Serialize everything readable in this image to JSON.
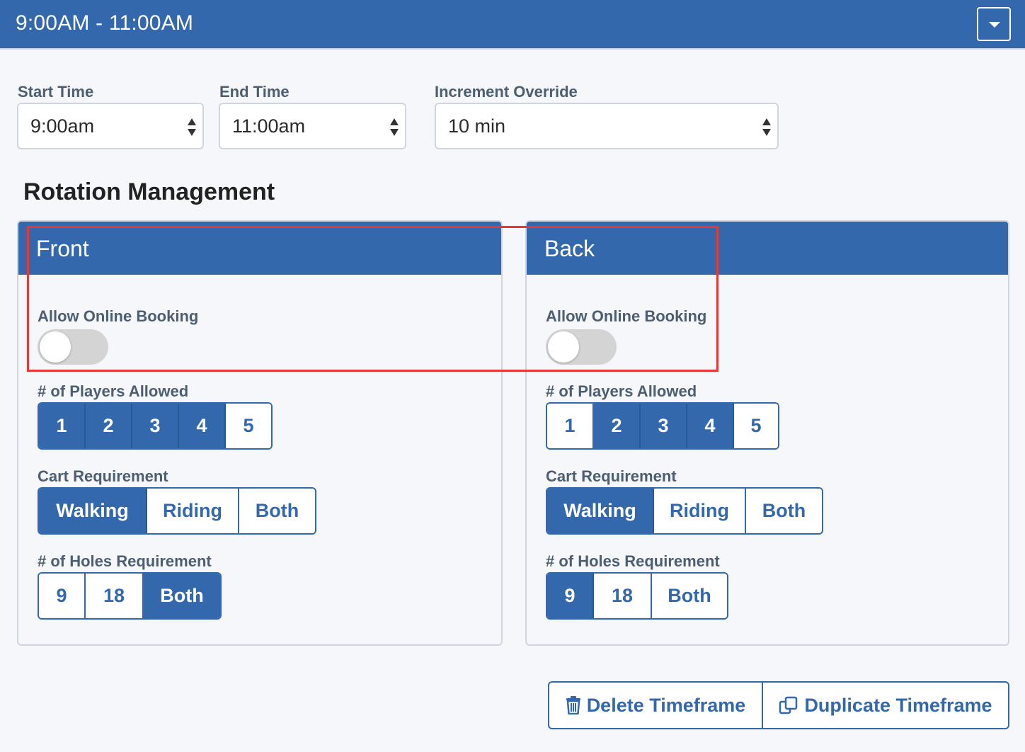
{
  "header": {
    "title": "9:00AM - 11:00AM",
    "toggle_icon": "caret-down-icon"
  },
  "form": {
    "start_time": {
      "label": "Start Time",
      "value": "9:00am"
    },
    "end_time": {
      "label": "End Time",
      "value": "11:00am"
    },
    "increment": {
      "label": "Increment Override",
      "value": "10 min"
    }
  },
  "rotation": {
    "title": "Rotation Management",
    "panels": [
      {
        "name": "Front",
        "online_label": "Allow Online Booking",
        "online_enabled": false,
        "players_label": "# of Players Allowed",
        "players": [
          "1",
          "2",
          "3",
          "4",
          "5"
        ],
        "players_selected": [
          "1",
          "2",
          "3",
          "4"
        ],
        "cart_label": "Cart Requirement",
        "cart": [
          "Walking",
          "Riding",
          "Both"
        ],
        "cart_selected": "Walking",
        "holes_label": "# of Holes Requirement",
        "holes": [
          "9",
          "18",
          "Both"
        ],
        "holes_selected": "Both"
      },
      {
        "name": "Back",
        "online_label": "Allow Online Booking",
        "online_enabled": false,
        "players_label": "# of Players Allowed",
        "players": [
          "1",
          "2",
          "3",
          "4",
          "5"
        ],
        "players_selected": [
          "2",
          "3",
          "4"
        ],
        "cart_label": "Cart Requirement",
        "cart": [
          "Walking",
          "Riding",
          "Both"
        ],
        "cart_selected": "Walking",
        "holes_label": "# of Holes Requirement",
        "holes": [
          "9",
          "18",
          "Both"
        ],
        "holes_selected": "9"
      }
    ]
  },
  "actions": {
    "delete_label": "Delete Timeframe",
    "duplicate_label": "Duplicate Timeframe"
  },
  "colors": {
    "primary": "#3468ad",
    "background": "#f5f7fb",
    "highlight": "#e53935",
    "toggle_off": "#d4d4d4"
  }
}
